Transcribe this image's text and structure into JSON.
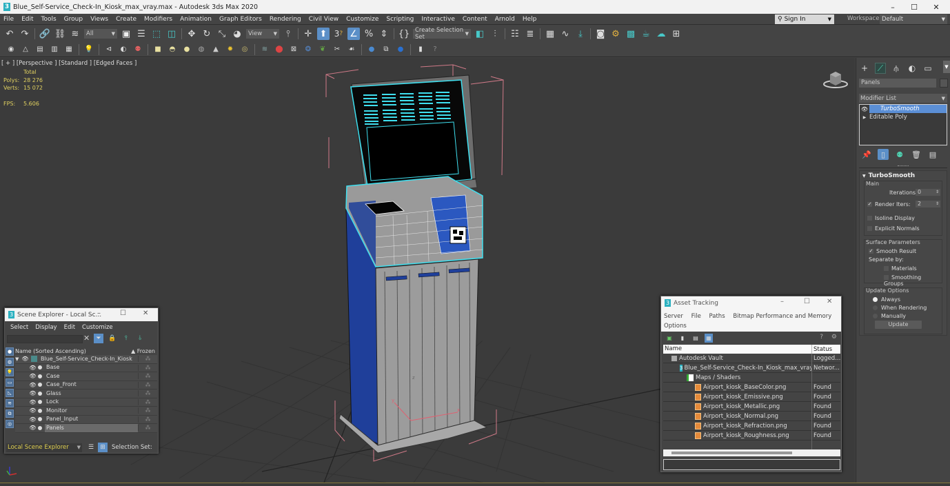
{
  "window": {
    "title": "Blue_Self-Service_Check-In_Kiosk_max_vray.max - Autodesk 3ds Max 2020",
    "app_icon": "3",
    "controls": {
      "minimize": "–",
      "maximize": "☐",
      "close": "✕"
    }
  },
  "menubar": {
    "items": [
      "File",
      "Edit",
      "Tools",
      "Group",
      "Views",
      "Create",
      "Modifiers",
      "Animation",
      "Graph Editors",
      "Rendering",
      "Civil View",
      "Customize",
      "Scripting",
      "Interactive",
      "Content",
      "Arnold",
      "Help"
    ],
    "sign_in": "Sign In",
    "workspaces_label": "Workspaces:",
    "workspace_value": "Default"
  },
  "toolbar": {
    "selection_filter": "All",
    "ref_coord": "View",
    "named_selection": "Create Selection Set",
    "snap_value": "3"
  },
  "viewport": {
    "label": "[ + ] [Perspective ] [Standard ] [Edged Faces ]",
    "stats": {
      "header": "Total",
      "polys_label": "Polys:",
      "polys": "28 276",
      "verts_label": "Verts:",
      "verts": "15 072",
      "fps_label": "FPS:",
      "fps": "5.606"
    },
    "gizmo_axes": {
      "x": "x",
      "y": "y",
      "z": "z"
    }
  },
  "command_panel": {
    "object_name": "Panels",
    "modifier_list": "Modifier List",
    "stack": [
      {
        "label": "TurboSmooth",
        "selected": true
      },
      {
        "label": "Editable Poly",
        "selected": false
      }
    ],
    "rollout": {
      "title": "TurboSmooth",
      "main_group": "Main",
      "iterations_label": "Iterations:",
      "iterations": "0",
      "render_iters_label": "Render Iters:",
      "render_iters": "2",
      "render_iters_checked": true,
      "isoline_label": "Isoline Display",
      "isoline_checked": false,
      "explicit_label": "Explicit Normals",
      "explicit_checked": false,
      "surface_group": "Surface Parameters",
      "smooth_result_label": "Smooth Result",
      "smooth_result_checked": true,
      "separate_by": "Separate by:",
      "materials_label": "Materials",
      "smoothing_groups_label": "Smoothing Groups",
      "update_group": "Update Options",
      "update_options": [
        "Always",
        "When Rendering",
        "Manually"
      ],
      "update_selected": "Always",
      "update_button": "Update"
    }
  },
  "scene_explorer": {
    "title": "Scene Explorer - Local Sc...",
    "menu": [
      "Select",
      "Display",
      "Edit",
      "Customize"
    ],
    "search_value": "",
    "col_name": "Name (Sorted Ascending)",
    "col_frozen": "▲ Frozen",
    "root": "Blue_Self-Service_Check-In_Kiosk",
    "items": [
      "Base",
      "Case",
      "Case_Front",
      "Glass",
      "Lock",
      "Monitor",
      "Panel_Input",
      "Panels"
    ],
    "selected_item": "Panels",
    "footer_dropdown": "Local Scene Explorer",
    "selection_set_label": "Selection Set:"
  },
  "asset_tracking": {
    "title": "Asset Tracking",
    "menu": [
      "Server",
      "File",
      "Paths",
      "Bitmap Performance and Memory",
      "Options"
    ],
    "col_name": "Name",
    "col_status": "Status",
    "rows": [
      {
        "name": "Autodesk Vault",
        "status": "Logged...",
        "indent": 0,
        "icon": "vault"
      },
      {
        "name": "Blue_Self-Service_Check-In_Kiosk_max_vray.max",
        "status": "Networ...",
        "indent": 1,
        "icon": "max"
      },
      {
        "name": "Maps / Shaders",
        "status": "",
        "indent": 2,
        "icon": "maps"
      },
      {
        "name": "Airport_kiosk_BaseColor.png",
        "status": "Found",
        "indent": 3,
        "icon": "png"
      },
      {
        "name": "Airport_kiosk_Emissive.png",
        "status": "Found",
        "indent": 3,
        "icon": "png"
      },
      {
        "name": "Airport_kiosk_Metallic.png",
        "status": "Found",
        "indent": 3,
        "icon": "png"
      },
      {
        "name": "Airport_kiosk_Normal.png",
        "status": "Found",
        "indent": 3,
        "icon": "png"
      },
      {
        "name": "Airport_kiosk_Refraction.png",
        "status": "Found",
        "indent": 3,
        "icon": "png"
      },
      {
        "name": "Airport_kiosk_Roughness.png",
        "status": "Found",
        "indent": 3,
        "icon": "png"
      }
    ]
  },
  "colors": {
    "accent_blue": "#5b8fc7",
    "selection_cyan": "#3fe0f0",
    "stats_yellow": "#e0d060",
    "bbox_pink": "#d07a88",
    "kiosk_blue": "#1f3f9a"
  }
}
